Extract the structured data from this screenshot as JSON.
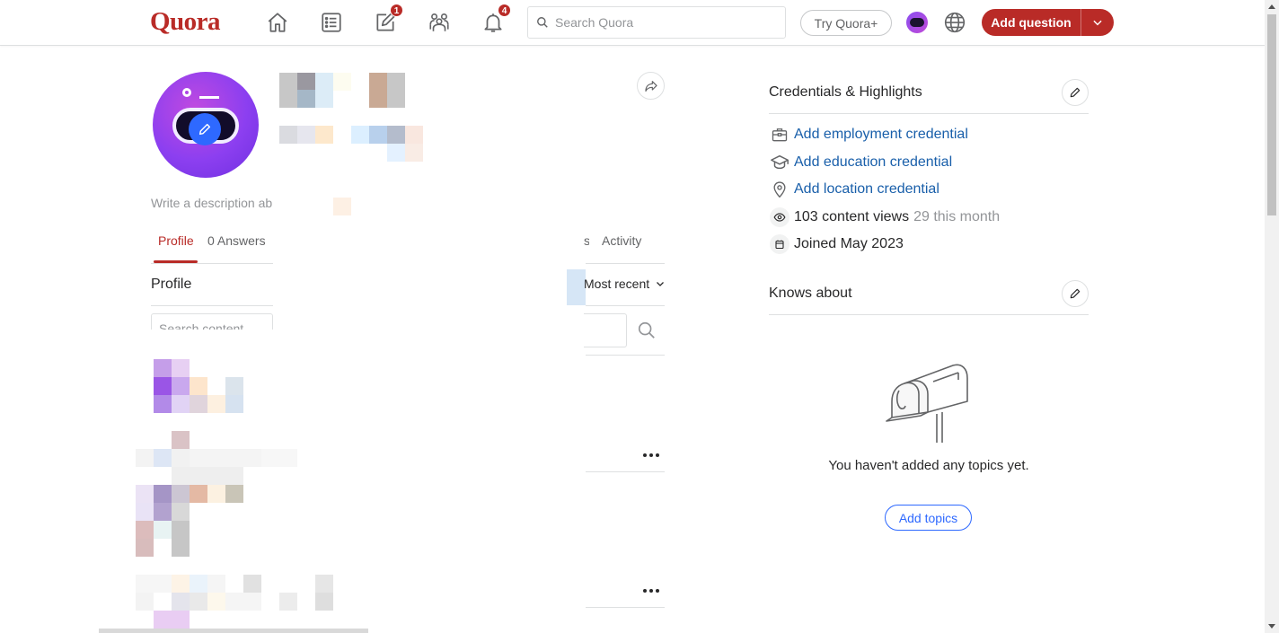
{
  "nav": {
    "logo": "Quora",
    "write_badge": "1",
    "notifications_badge": "4",
    "search_placeholder": "Search Quora",
    "try_plus": "Try Quora+",
    "add_question": "Add question"
  },
  "profile": {
    "description_placeholder": "Write a description ab",
    "tabs": [
      {
        "label": "Profile",
        "active": true
      },
      {
        "label": "0 Answers"
      },
      {
        "label": "s"
      },
      {
        "label": "Activity"
      }
    ],
    "section_title": "Profile",
    "sort": "Most recent",
    "search_placeholder": "Search content"
  },
  "credentials": {
    "title": "Credentials & Highlights",
    "items": [
      {
        "icon": "briefcase-icon",
        "label": "Add employment credential"
      },
      {
        "icon": "graduation-cap-icon",
        "label": "Add education credential"
      },
      {
        "icon": "location-pin-icon",
        "label": "Add location credential"
      }
    ],
    "views": "103 content views",
    "views_month": "29 this month",
    "joined": "Joined May 2023"
  },
  "knows_about": {
    "title": "Knows about",
    "empty": "You haven't added any topics yet.",
    "add_topics": "Add topics"
  },
  "colors": {
    "brand": "#b92b27",
    "link": "#195faa",
    "accent": "#2e69ff"
  }
}
